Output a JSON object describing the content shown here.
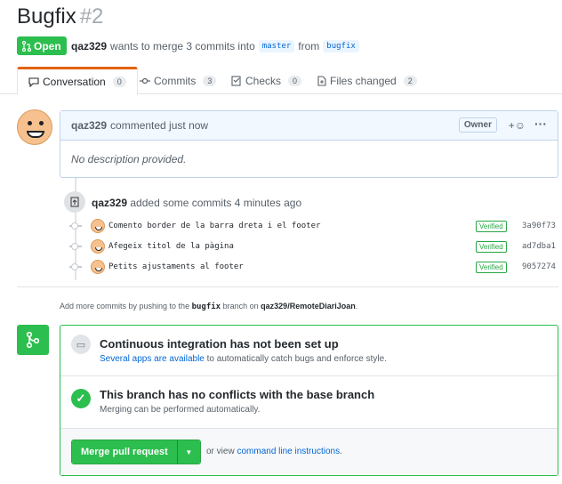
{
  "pr": {
    "title": "Bugfix",
    "number": "#2",
    "status": "Open",
    "author": "qaz329",
    "merge_text": "wants to merge 3 commits into",
    "base_branch": "master",
    "from_text": "from",
    "head_branch": "bugfix"
  },
  "tabs": [
    {
      "label": "Conversation",
      "count": "0"
    },
    {
      "label": "Commits",
      "count": "3"
    },
    {
      "label": "Checks",
      "count": "0"
    },
    {
      "label": "Files changed",
      "count": "2"
    }
  ],
  "comment": {
    "author": "qaz329",
    "action": "commented just now",
    "role": "Owner",
    "body": "No description provided."
  },
  "push_event": {
    "author": "qaz329",
    "text": "added some commits 4 minutes ago"
  },
  "commits": [
    {
      "message": "Comento border de la barra dreta i el footer",
      "verified": "Verified",
      "sha": "3a90f73"
    },
    {
      "message": "Afegeix titol de la pàgina",
      "verified": "Verified",
      "sha": "ad7dba1"
    },
    {
      "message": "Petits ajustaments al footer",
      "verified": "Verified",
      "sha": "9057274"
    }
  ],
  "hint": {
    "prefix": "Add more commits by pushing to the",
    "branch": "bugfix",
    "middle": "branch on",
    "repo": "qaz329/RemoteDiariJoan",
    "suffix": "."
  },
  "merge": {
    "ci_title": "Continuous integration has not been set up",
    "ci_link": "Several apps are available",
    "ci_rest": "to automatically catch bugs and enforce style.",
    "conflict_title": "This branch has no conflicts with the base branch",
    "conflict_sub": "Merging can be performed automatically.",
    "button": "Merge pull request",
    "or_view": "or view",
    "cli_link": "command line instructions",
    "period": "."
  },
  "colors": {
    "green": "#2cbe4e",
    "link": "#0366d6",
    "tab_accent": "#e36209"
  }
}
